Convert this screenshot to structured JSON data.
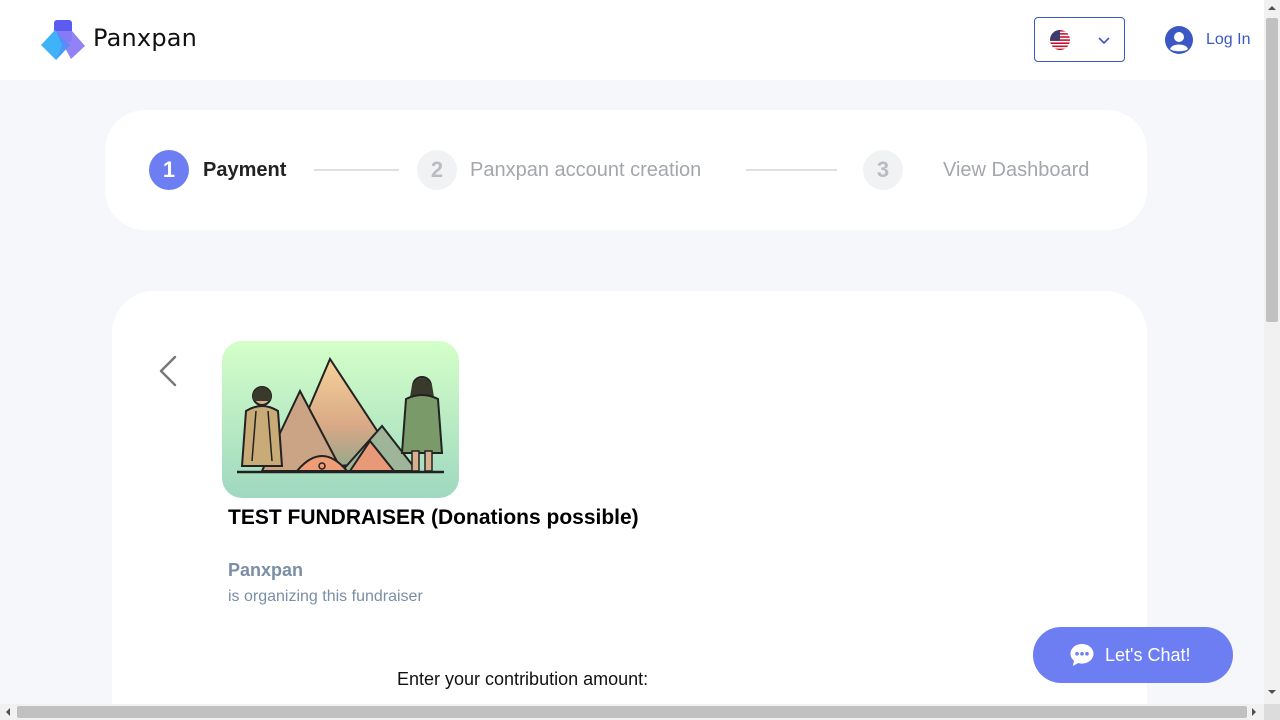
{
  "header": {
    "brand": "Panxpan",
    "language_icon": "us-flag-icon",
    "login_label": "Log In"
  },
  "stepper": {
    "steps": [
      {
        "number": "1",
        "label": "Payment",
        "state": "active"
      },
      {
        "number": "2",
        "label": "Panxpan account creation",
        "state": "inactive"
      },
      {
        "number": "3",
        "label": "View Dashboard",
        "state": "inactive"
      }
    ]
  },
  "fundraiser": {
    "title": "TEST FUNDRAISER (Donations possible)",
    "organizer": "Panxpan",
    "organizer_caption": "is organizing this fundraiser",
    "contribution_prompt": "Enter your contribution amount:"
  },
  "chat": {
    "label": "Let's Chat!"
  },
  "colors": {
    "accent": "#6c7ef2",
    "link": "#3b57c4",
    "muted": "#7a8ea5",
    "background": "#f5f7fa"
  }
}
